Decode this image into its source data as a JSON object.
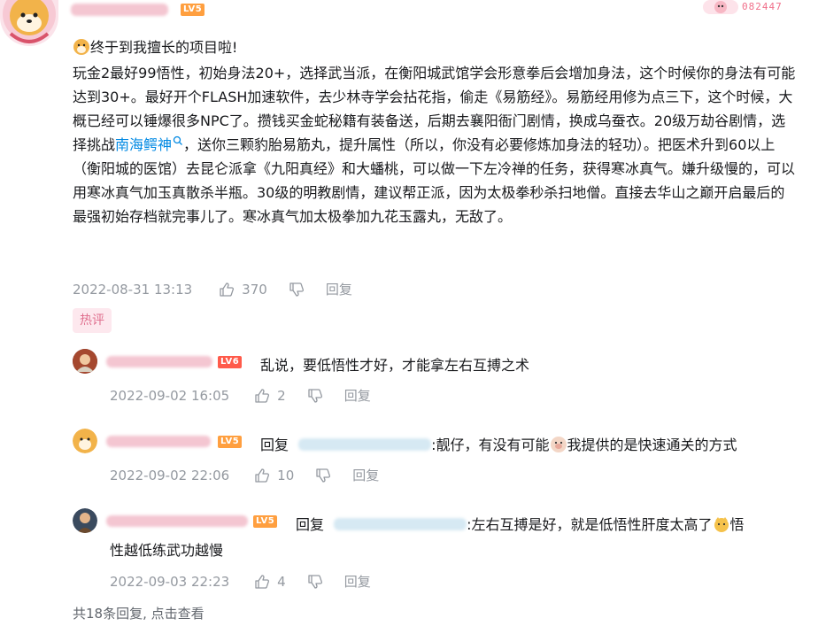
{
  "main": {
    "level": "LV5",
    "right_badge": "082447",
    "intro": "终于到我擅长的项目啦!",
    "body_part1": "玩金2最好99悟性，初始身法20+，选择武当派，在衡阳城武馆学会形意拳后会增加身法，这个时候你的身法有可能达到30+。最好开个FLASH加速软件，去少林寺学会拈花指，偷走《易筋经》。易筋经用修为点三下，这个时候，大概已经可以锤爆很多NPC了。攒钱买金蛇秘籍有装备送，后期去襄阳衙门剧情，换成乌蚕衣。20级万劫谷剧情，选择挑战",
    "body_link": "南海鳄神",
    "body_part2": "，送你三颗豹胎易筋丸，提升属性（所以，你没有必要修炼加身法的轻功）。把医术升到60以上（衡阳城的医馆）去昆仑派拿《九阳真经》和大蟠桃，可以做一下左冷禅的任务，获得寒冰真气。嫌升级慢的，可以用寒冰真气加玉真散杀半瓶。30级的明教剧情，建议帮正派，因为太极拳秒杀扫地僧。直接去华山之巅开启最后的最强初始存档就完事儿了。寒冰真气加太极拳加九花玉露丸，无敌了。",
    "time": "2022-08-31 13:13",
    "likes": "370",
    "reply": "回复"
  },
  "hot_tag": "热评",
  "replies": [
    {
      "level": "LV6",
      "text": "乱说，要低悟性才好，才能拿左右互搏之术",
      "time": "2022-09-02 16:05",
      "likes": "2",
      "reply": "回复"
    },
    {
      "level": "LV5",
      "prefix": "回复",
      "text_a": ":靓仔，有没有可能",
      "text_b": "我提供的是快速通关的方式",
      "time": "2022-09-02 22:06",
      "likes": "10",
      "reply": "回复"
    },
    {
      "level": "LV5",
      "prefix": "回复",
      "text_a": ":左右互搏是好，就是低悟性肝度太高了",
      "text_b": "悟",
      "text_c": "性越低练武功越慢",
      "time": "2022-09-03 22:23",
      "likes": "4",
      "reply": "回复"
    }
  ],
  "footer": "共18条回复, 点击查看",
  "colors": {
    "accent_link": "#0089e3",
    "meta_gray": "#9499a0",
    "level5": "#ff9f3f",
    "level6": "#ff5a4a",
    "hot_tag_bg": "#fde8ee",
    "hot_tag_fg": "#e0708f"
  }
}
